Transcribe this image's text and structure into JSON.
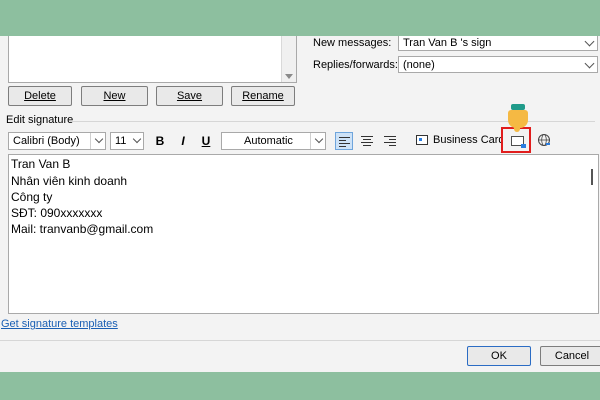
{
  "signature_selector": {
    "new_messages_label": "New messages:",
    "new_messages_value": "Tran Van B 's sign",
    "replies_label": "Replies/forwards:",
    "replies_value": "(none)"
  },
  "list_buttons": {
    "delete": "Delete",
    "new": "New",
    "save": "Save",
    "rename": "Rename"
  },
  "edit_section_title": "Edit signature",
  "toolbar": {
    "font": "Calibri (Body)",
    "size": "11",
    "bold": "B",
    "italic": "I",
    "underline": "U",
    "color": "Automatic",
    "business_card": "Business Card"
  },
  "signature_lines": [
    "Tran Van B",
    "Nhân viên kinh doanh",
    "Công ty",
    "SĐT: 090xxxxxxx",
    "Mail: tranvanb@gmail.com"
  ],
  "templates_link": "Get signature templates",
  "dialog_buttons": {
    "ok": "OK",
    "cancel": "Cancel"
  },
  "colors": {
    "background": "#8dbf9f",
    "highlight": "#e11d1d",
    "link": "#1a5fb4"
  }
}
